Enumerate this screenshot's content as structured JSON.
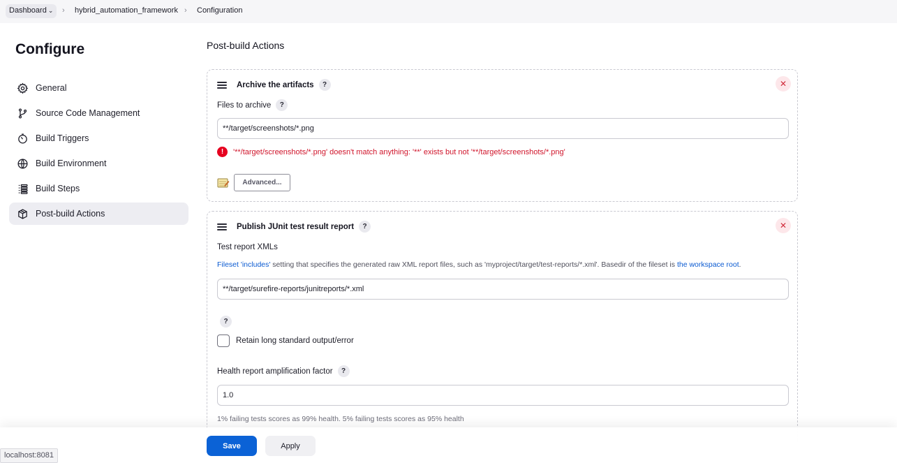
{
  "breadcrumb": {
    "items": [
      "Dashboard",
      "hybrid_automation_framework",
      "Configuration"
    ]
  },
  "sidebar": {
    "title": "Configure",
    "items": [
      {
        "label": "General",
        "icon": "gear-icon"
      },
      {
        "label": "Source Code Management",
        "icon": "branch-icon"
      },
      {
        "label": "Build Triggers",
        "icon": "timer-icon"
      },
      {
        "label": "Build Environment",
        "icon": "globe-icon"
      },
      {
        "label": "Build Steps",
        "icon": "list-icon"
      },
      {
        "label": "Post-build Actions",
        "icon": "box-icon",
        "active": true
      }
    ]
  },
  "main": {
    "section_title": "Post-build Actions",
    "archive": {
      "title": "Archive the artifacts",
      "files_label": "Files to archive",
      "files_value": "**/target/screenshots/*.png",
      "error": "'**/target/screenshots/*.png' doesn't match anything: '**' exists but not '**/target/screenshots/*.png'",
      "advanced_label": "Advanced..."
    },
    "junit": {
      "title": "Publish JUnit test result report",
      "xml_label": "Test report XMLs",
      "desc_link1": "Fileset 'includes'",
      "desc_text": " setting that specifies the generated raw XML report files, such as 'myproject/target/test-reports/*.xml'. Basedir of the fileset is ",
      "desc_link2": "the workspace root",
      "desc_end": ".",
      "xml_value": "**/target/surefire-reports/junitreports/*.xml",
      "retain_label": "Retain long standard output/error",
      "retain_checked": false,
      "health_label": "Health report amplification factor",
      "health_value": "1.0",
      "health_hint": "1% failing tests scores as 99% health. 5% failing tests scores as 95% health"
    }
  },
  "footer": {
    "save_label": "Save",
    "apply_label": "Apply"
  },
  "status_bar": {
    "url": "localhost:8081"
  },
  "colors": {
    "accent": "#0b62d6",
    "error": "#d0152b",
    "link": "#0a5ad1"
  }
}
